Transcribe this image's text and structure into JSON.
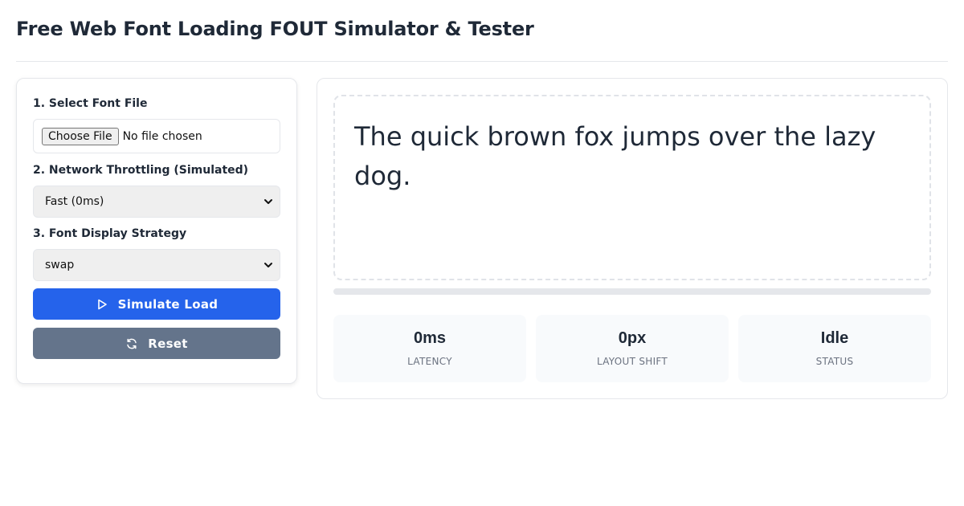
{
  "header": {
    "title": "Free Web Font Loading FOUT Simulator & Tester"
  },
  "controls": {
    "font_file": {
      "label": "1. Select Font File",
      "button_label": "Choose File",
      "status": "No file chosen"
    },
    "throttling": {
      "label": "2. Network Throttling (Simulated)",
      "selected": "Fast (0ms)"
    },
    "strategy": {
      "label": "3. Font Display Strategy",
      "selected": "swap"
    },
    "simulate_label": "Simulate Load",
    "reset_label": "Reset"
  },
  "preview": {
    "sample_text": "The quick brown fox jumps over the lazy dog.",
    "progress": 0
  },
  "stats": [
    {
      "value": "0ms",
      "label": "Latency"
    },
    {
      "value": "0px",
      "label": "Layout Shift"
    },
    {
      "value": "Idle",
      "label": "Status"
    }
  ],
  "colors": {
    "primary": "#2563eb",
    "secondary": "#64748b"
  },
  "icons": {
    "simulate": "play-icon",
    "reset": "refresh-icon",
    "select": "chevron-down-icon"
  }
}
